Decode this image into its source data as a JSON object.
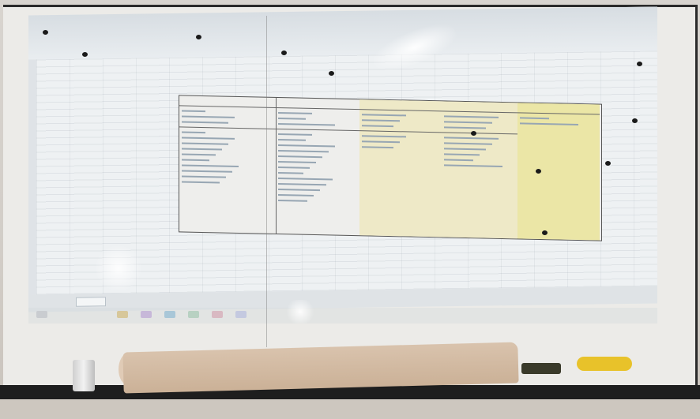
{
  "photo": {
    "sheet_tab_label": "",
    "table": {
      "columns": [
        {
          "id": "col-1",
          "head": "",
          "highlight": "none",
          "sections": [
            [
              3
            ],
            [
              10
            ]
          ]
        },
        {
          "id": "col-2",
          "head": "",
          "highlight": "none",
          "sections": [
            [
              3
            ],
            [
              13
            ]
          ]
        },
        {
          "id": "col-3",
          "head": "",
          "highlight": "light-yellow",
          "sections": [
            [
              3
            ],
            [
              3
            ]
          ]
        },
        {
          "id": "col-4",
          "head": "",
          "highlight": "light-yellow",
          "sections": [
            [
              3
            ],
            [
              6
            ]
          ]
        },
        {
          "id": "col-5",
          "head": "",
          "highlight": "yellow",
          "sections": [
            [
              2
            ]
          ]
        }
      ]
    }
  }
}
